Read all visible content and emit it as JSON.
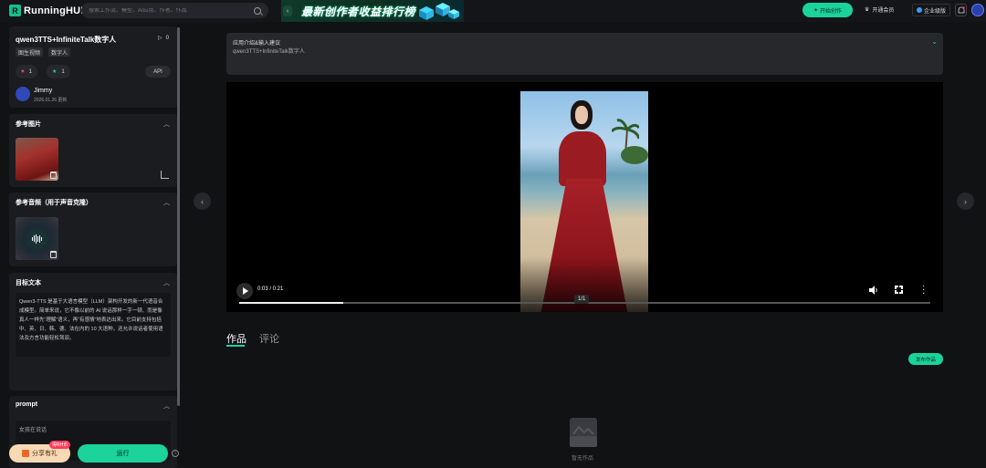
{
  "header": {
    "logo_text": "RunningHUB",
    "search_placeholder": "搜索工作流、模型、AI应用、作者、作品",
    "banner_text": "最新创作者收益排行榜",
    "create_button": "开始创作",
    "vip_label": "开通会员",
    "enterprise_label": "企业级版"
  },
  "sidebar": {
    "app_title": "qwen3TTS+InfiniteTalk数字人",
    "play_count": "0",
    "tags": [
      "图生视频",
      "数字人"
    ],
    "likes": "1",
    "favorites": "1",
    "api_label": "API",
    "author_name": "Jimmy",
    "author_date": "2026.01.26 更新",
    "sections": {
      "ref_image": "参考图片",
      "ref_audio": "参考音频（用于声音克隆）",
      "target_text": "目标文本",
      "prompt": "prompt"
    },
    "target_text_value": "Qwen3-TTS 是基于大语言模型（LLM）架构开发的新一代语音合成模型。简单来说，它不像以前的 AI 说话那样一字一顿、而是像真人一样先“理解”语义，再“有感情”地表达出来。它目前支持包括中、英、日、韩、德、法在内的 10 大语种，还允许说话者使用语法及方言功能轻松驾驭。",
    "prompt_value": "女孩在说话",
    "share_label": "分享有礼",
    "share_badge": "得RH币",
    "run_label": "运行"
  },
  "main": {
    "desc_title": "应用介绍&输入建议",
    "desc_subtitle": "qwen3TTS+InfiniteTalk数字人",
    "video_time": "0:03 / 0:21",
    "video_progress": 0.15,
    "page_indicator": "1/1",
    "tabs": [
      "作品",
      "评论"
    ],
    "publish_label": "发布作品",
    "empty_text": "暂无作品"
  },
  "colors": {
    "accent": "#1bd39b",
    "background": "#111214",
    "card": "#1b1c20"
  }
}
